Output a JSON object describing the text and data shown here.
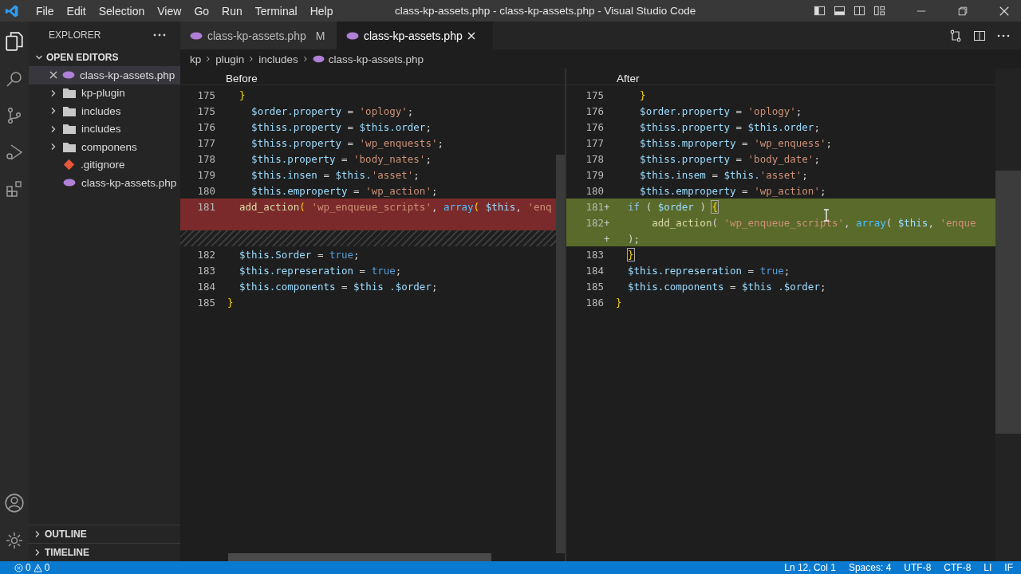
{
  "title_bar": {
    "menu": [
      "File",
      "Edit",
      "Selection",
      "View",
      "Go",
      "Run",
      "Terminal",
      "Help"
    ],
    "title": "class-kp-assets.php - class-kp-assets.php - Visual Studio Code"
  },
  "sidebar": {
    "title": "EXPLORER",
    "section": {
      "label": "OPEN EDITORS",
      "expanded": true
    },
    "open_editors": [
      {
        "name": "class-kp-assets.php",
        "selected": true
      }
    ],
    "items": [
      {
        "name": "kp-plugin",
        "kind": "folder"
      },
      {
        "name": "includes",
        "kind": "folder"
      },
      {
        "name": "includes",
        "kind": "folder"
      },
      {
        "name": "componens",
        "kind": "folder"
      },
      {
        "name": ".gitignore",
        "kind": "git"
      },
      {
        "name": "class-kp-assets.php",
        "kind": "php"
      }
    ],
    "bottom_sections": [
      {
        "label": "OUTLINE",
        "expanded": false
      },
      {
        "label": "TIMELINE",
        "expanded": false
      }
    ]
  },
  "tabs": [
    {
      "label": "class-kp-assets.php",
      "badge": "M",
      "selected": false
    },
    {
      "label": "class-kp-assets.php",
      "selected": true
    }
  ],
  "breadcrumbs": [
    "kp",
    "plugin",
    "includes",
    "class-kp-assets.php"
  ],
  "diff": {
    "left": {
      "title": "Before",
      "lines": [
        {
          "number": "175",
          "kind": "normal",
          "tokens": [
            {
              "text": "  }",
              "kind": "brace"
            }
          ]
        },
        {
          "number": "175",
          "kind": "normal",
          "tokens": [
            {
              "text": "    $order.property",
              "kind": "var"
            },
            {
              "text": " = ",
              "kind": "op"
            },
            {
              "text": "'oplogy'",
              "kind": "str"
            },
            {
              "text": ";",
              "kind": "op"
            }
          ]
        },
        {
          "number": "176",
          "kind": "normal",
          "tokens": [
            {
              "text": "    $thiss.property",
              "kind": "var"
            },
            {
              "text": " = ",
              "kind": "op"
            },
            {
              "text": "$this.order",
              "kind": "var"
            },
            {
              "text": ";",
              "kind": "op"
            }
          ]
        },
        {
          "number": "177",
          "kind": "normal",
          "tokens": [
            {
              "text": "    $thiss.property",
              "kind": "var"
            },
            {
              "text": " = ",
              "kind": "op"
            },
            {
              "text": "'wp_enquests'",
              "kind": "str"
            },
            {
              "text": ";",
              "kind": "op"
            }
          ]
        },
        {
          "number": "178",
          "kind": "normal",
          "tokens": [
            {
              "text": "    $this.property",
              "kind": "var"
            },
            {
              "text": " = ",
              "kind": "op"
            },
            {
              "text": "'body_nates'",
              "kind": "str"
            },
            {
              "text": ";",
              "kind": "op"
            }
          ]
        },
        {
          "number": "179",
          "kind": "normal",
          "tokens": [
            {
              "text": "    $this.insen",
              "kind": "var"
            },
            {
              "text": " = ",
              "kind": "op"
            },
            {
              "text": "$this.",
              "kind": "var"
            },
            {
              "text": "'asset'",
              "kind": "str"
            },
            {
              "text": ";",
              "kind": "op"
            }
          ]
        },
        {
          "number": "180",
          "kind": "normal",
          "tokens": [
            {
              "text": "    $this.emproperty",
              "kind": "var"
            },
            {
              "text": " = ",
              "kind": "op"
            },
            {
              "text": "'wp_action'",
              "kind": "str"
            },
            {
              "text": ";",
              "kind": "op"
            }
          ]
        },
        {
          "number": "181",
          "kind": "removed",
          "tokens": [
            {
              "text": "  add_action",
              "kind": "func"
            },
            {
              "text": "( ",
              "kind": "brace"
            },
            {
              "text": "'wp_enqueue_scripts'",
              "kind": "str"
            },
            {
              "text": ", ",
              "kind": "op"
            },
            {
              "text": "array",
              "kind": "builtin"
            },
            {
              "text": "( ",
              "kind": "brace"
            },
            {
              "text": "$this",
              "kind": "var"
            },
            {
              "text": ", ",
              "kind": "op"
            },
            {
              "text": "'enq",
              "kind": "str"
            }
          ]
        },
        {
          "kind": "removed"
        },
        {
          "kind": "filler"
        },
        {
          "number": "182",
          "kind": "normal",
          "tokens": [
            {
              "text": "  $this.Sorder",
              "kind": "var"
            },
            {
              "text": " = ",
              "kind": "op"
            },
            {
              "text": "true",
              "kind": "bool"
            },
            {
              "text": ";",
              "kind": "op"
            }
          ]
        },
        {
          "number": "183",
          "kind": "normal",
          "tokens": [
            {
              "text": "  $this.represeration",
              "kind": "var"
            },
            {
              "text": " = ",
              "kind": "op"
            },
            {
              "text": "true",
              "kind": "bool"
            },
            {
              "text": ";",
              "kind": "op"
            }
          ]
        },
        {
          "number": "184",
          "kind": "normal",
          "tokens": [
            {
              "text": "  $this.components",
              "kind": "var"
            },
            {
              "text": " = ",
              "kind": "op"
            },
            {
              "text": "$this .$order",
              "kind": "var"
            },
            {
              "text": ";",
              "kind": "op"
            }
          ]
        },
        {
          "number": "185",
          "kind": "normal",
          "tokens": [
            {
              "text": "}",
              "kind": "brace"
            }
          ]
        }
      ]
    },
    "right": {
      "title": "After",
      "lines": [
        {
          "number": "175",
          "kind": "normal",
          "tokens": [
            {
              "text": "    }",
              "kind": "brace"
            }
          ]
        },
        {
          "number": "176",
          "kind": "normal",
          "tokens": [
            {
              "text": "    $order.property",
              "kind": "var"
            },
            {
              "text": " = ",
              "kind": "op"
            },
            {
              "text": "'oplogy'",
              "kind": "str"
            },
            {
              "text": ";",
              "kind": "op"
            }
          ]
        },
        {
          "number": "176",
          "kind": "normal",
          "tokens": [
            {
              "text": "    $thiss.property",
              "kind": "var"
            },
            {
              "text": " = ",
              "kind": "op"
            },
            {
              "text": "$this.order",
              "kind": "var"
            },
            {
              "text": ";",
              "kind": "op"
            }
          ]
        },
        {
          "number": "177",
          "kind": "normal",
          "tokens": [
            {
              "text": "    $thiss.mproperty",
              "kind": "var"
            },
            {
              "text": " = ",
              "kind": "op"
            },
            {
              "text": "'wp_enquess'",
              "kind": "str"
            },
            {
              "text": ";",
              "kind": "op"
            }
          ]
        },
        {
          "number": "178",
          "kind": "normal",
          "tokens": [
            {
              "text": "    $thiss.property",
              "kind": "var"
            },
            {
              "text": " = ",
              "kind": "op"
            },
            {
              "text": "'body_date'",
              "kind": "str"
            },
            {
              "text": ";",
              "kind": "op"
            }
          ]
        },
        {
          "number": "179",
          "kind": "normal",
          "tokens": [
            {
              "text": "    $this.insem",
              "kind": "var"
            },
            {
              "text": " = ",
              "kind": "op"
            },
            {
              "text": "$this.",
              "kind": "var"
            },
            {
              "text": "'asset'",
              "kind": "str"
            },
            {
              "text": ";",
              "kind": "op"
            }
          ]
        },
        {
          "number": "180",
          "kind": "normal",
          "tokens": [
            {
              "text": "    $this.emproperty",
              "kind": "var"
            },
            {
              "text": " = ",
              "kind": "op"
            },
            {
              "text": "'wp_action'",
              "kind": "str"
            },
            {
              "text": ";",
              "kind": "op"
            }
          ]
        },
        {
          "number": "181",
          "marker": "+",
          "kind": "added",
          "tokens": [
            {
              "text": "  if",
              "kind": "keyword"
            },
            {
              "text": " ( ",
              "kind": "op"
            },
            {
              "text": "$order",
              "kind": "var"
            },
            {
              "text": " ) ",
              "kind": "op"
            },
            {
              "text": "{",
              "kind": "match"
            }
          ]
        },
        {
          "number": "182",
          "marker": "+",
          "kind": "added",
          "tokens": [
            {
              "text": "      add_action",
              "kind": "func"
            },
            {
              "text": "( ",
              "kind": "op"
            },
            {
              "text": "'wp_enqueue_scripts'",
              "kind": "str"
            },
            {
              "text": ", ",
              "kind": "op"
            },
            {
              "text": "array",
              "kind": "builtin"
            },
            {
              "text": "( ",
              "kind": "op"
            },
            {
              "text": "$this",
              "kind": "var"
            },
            {
              "text": ", ",
              "kind": "op"
            },
            {
              "text": "'enque",
              "kind": "str"
            }
          ]
        },
        {
          "marker": "+",
          "kind": "added",
          "tokens": [
            {
              "text": "  );",
              "kind": "op"
            }
          ]
        },
        {
          "number": "183",
          "kind": "normal",
          "tokens": [
            {
              "text": "  }",
              "kind": "match"
            }
          ]
        },
        {
          "number": "184",
          "kind": "normal",
          "tokens": [
            {
              "text": "  $this.represeration",
              "kind": "var"
            },
            {
              "text": " = ",
              "kind": "op"
            },
            {
              "text": "true",
              "kind": "bool"
            },
            {
              "text": ";",
              "kind": "op"
            }
          ]
        },
        {
          "number": "185",
          "kind": "normal",
          "tokens": [
            {
              "text": "  $this.components",
              "kind": "var"
            },
            {
              "text": " = ",
              "kind": "op"
            },
            {
              "text": "$this .$order",
              "kind": "var"
            },
            {
              "text": ";",
              "kind": "op"
            }
          ]
        },
        {
          "number": "186",
          "kind": "normal",
          "tokens": [
            {
              "text": "}",
              "kind": "brace"
            }
          ]
        }
      ]
    }
  },
  "status_bar": {
    "errors": "0",
    "warnings": "0",
    "items": [
      "Ln 12, Col 1",
      "Spaces: 4",
      "UTF-8",
      "CTF-8",
      "LI",
      "IF"
    ]
  }
}
